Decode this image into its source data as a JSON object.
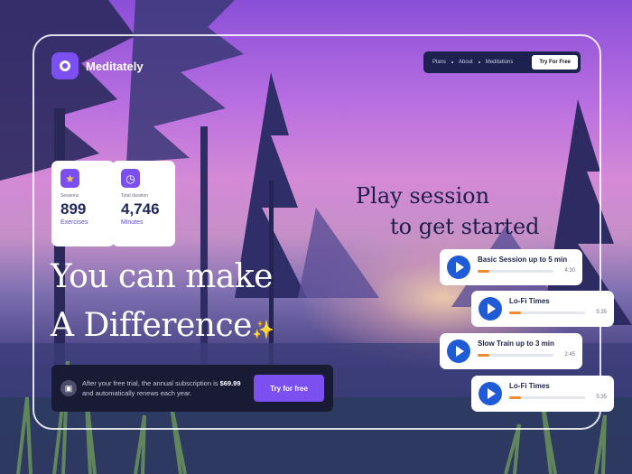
{
  "brand": {
    "name": "Meditately"
  },
  "nav": {
    "links": [
      "Plans",
      "About",
      "Meditations"
    ],
    "cta": "Try For Free"
  },
  "stats": [
    {
      "icon": "star-icon",
      "label": "Sessions",
      "value": "899",
      "sub": "Exercises"
    },
    {
      "icon": "clock-icon",
      "label": "Total duration",
      "value": "4,746",
      "sub": "Minutes"
    }
  ],
  "hero": {
    "line1": "You can make",
    "line2": "A Difference"
  },
  "promo": {
    "text_before": "After your free trial, the annual subscription is ",
    "price": "$69.99",
    "text_after": " and automatically renews each year.",
    "button": "Try for free"
  },
  "sessions": {
    "title_line1": "Play session",
    "title_line2": "to get started",
    "items": [
      {
        "title": "Basic Session up to 5 min",
        "duration": "4:30",
        "progress": 0.15
      },
      {
        "title": "Lo-Fi Times",
        "duration": "5:35",
        "progress": 0.15
      },
      {
        "title": "Slow Train up to 3 min",
        "duration": "2:45",
        "progress": 0.15
      },
      {
        "title": "Lo-Fi Times",
        "duration": "5:35",
        "progress": 0.15
      }
    ]
  },
  "colors": {
    "accent": "#7b4ff0",
    "play": "#1f5bd6",
    "progress": "#f08a2e",
    "nav_bg": "#1c2150"
  }
}
